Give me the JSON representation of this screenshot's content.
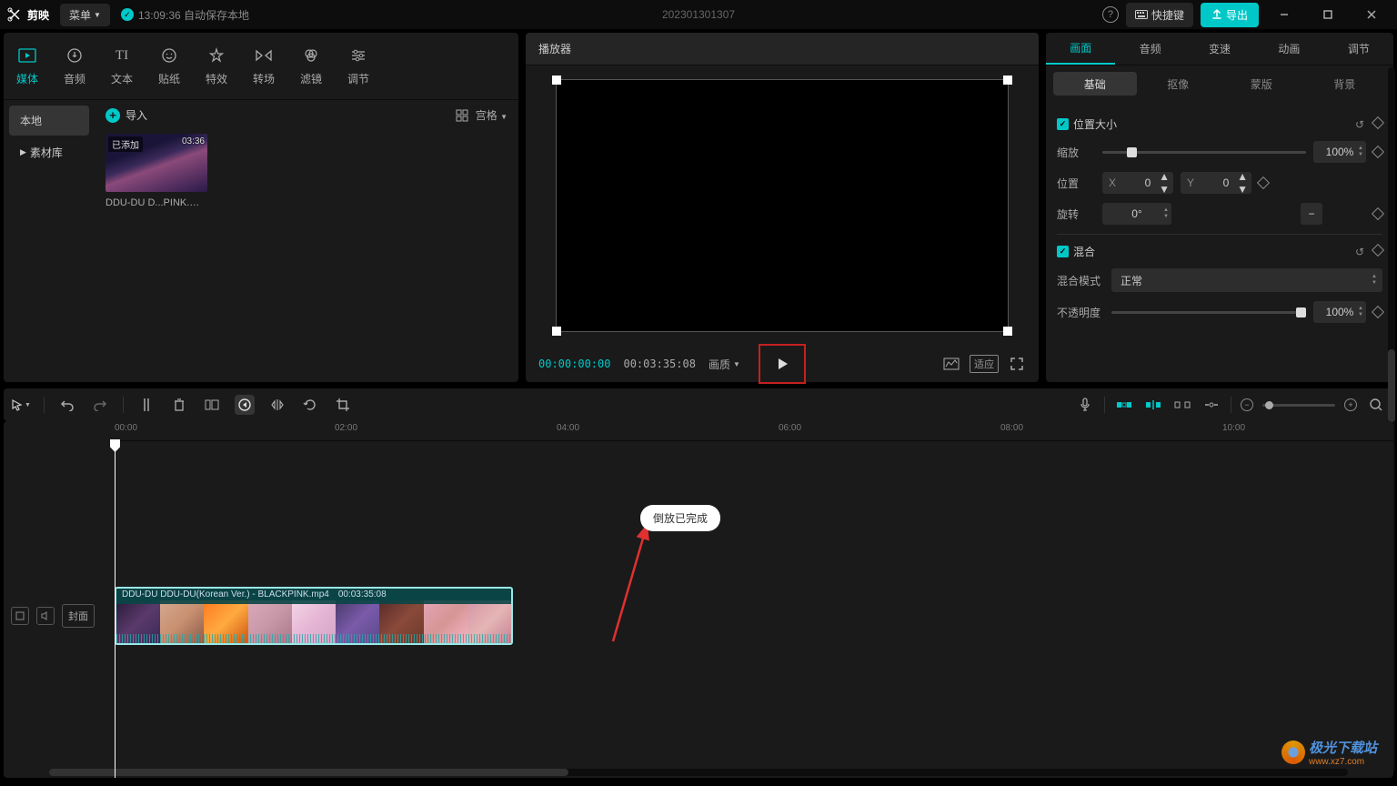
{
  "titlebar": {
    "app_name": "剪映",
    "menu": "菜单",
    "autosave": "13:09:36 自动保存本地",
    "project": "202301301307",
    "shortcut": "快捷键",
    "export": "导出"
  },
  "media_tabs": {
    "media": "媒体",
    "audio": "音频",
    "text": "文本",
    "sticker": "贴纸",
    "effect": "特效",
    "transition": "转场",
    "filter": "滤镜",
    "adjust": "调节"
  },
  "media_side": {
    "local": "本地",
    "library": "素材库"
  },
  "media": {
    "import": "导入",
    "view_label": "宫格",
    "thumb_badge": "已添加",
    "thumb_duration": "03:36",
    "thumb_name": "DDU-DU D...PINK.mp4"
  },
  "player": {
    "title": "播放器",
    "time_cur": "00:00:00:00",
    "time_total": "00:03:35:08",
    "quality": "画质",
    "ratio": "适应"
  },
  "props_tabs": {
    "picture": "画面",
    "audio": "音频",
    "speed": "变速",
    "anim": "动画",
    "adjust": "调节"
  },
  "props_sub": {
    "basic": "基础",
    "cutout": "抠像",
    "mask": "蒙版",
    "bg": "背景"
  },
  "props": {
    "pos_size": "位置大小",
    "scale": "缩放",
    "scale_val": "100%",
    "position": "位置",
    "pos_x": "0",
    "pos_y": "0",
    "rotation": "旋转",
    "rot_val": "0°",
    "blend": "混合",
    "blend_mode": "混合模式",
    "blend_val": "正常",
    "opacity": "不透明度",
    "opacity_val": "100%"
  },
  "timeline": {
    "cover": "封面",
    "marks": [
      "00:00",
      "02:00",
      "04:00",
      "06:00",
      "08:00",
      "10:00"
    ],
    "clip_name": "DDU-DU DDU-DU(Korean Ver.) - BLACKPINK.mp4",
    "clip_dur": "00:03:35:08",
    "toast": "倒放已完成"
  },
  "watermark": {
    "name": "极光下载站",
    "url": "www.xz7.com"
  }
}
